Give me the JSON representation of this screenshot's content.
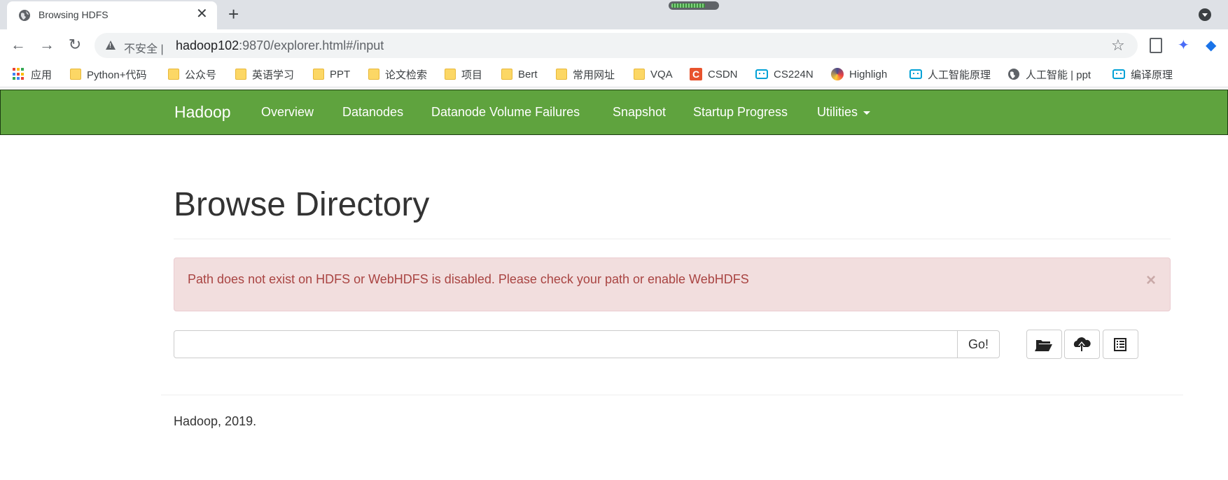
{
  "browser": {
    "tab_title": "Browsing HDFS",
    "tab_close": "✕",
    "new_tab": "+",
    "security_label": "不安全 |",
    "url_host": "hadoop102",
    "url_rest": ":9870/explorer.html#/input",
    "nav": {
      "back": "←",
      "forward": "→",
      "reload": "↻"
    },
    "star": "☆"
  },
  "bookmarks": [
    {
      "label": "应用",
      "icon": "apps-grid-icon"
    },
    {
      "label": "Python+代码",
      "icon": "folder-icon"
    },
    {
      "label": "公众号",
      "icon": "folder-icon"
    },
    {
      "label": "英语学习",
      "icon": "folder-icon"
    },
    {
      "label": "PPT",
      "icon": "folder-icon"
    },
    {
      "label": "论文检索",
      "icon": "folder-icon"
    },
    {
      "label": "项目",
      "icon": "folder-icon"
    },
    {
      "label": "Bert",
      "icon": "folder-icon"
    },
    {
      "label": "常用网址",
      "icon": "folder-icon"
    },
    {
      "label": "VQA",
      "icon": "folder-icon"
    },
    {
      "label": "CSDN",
      "icon": "csdn-icon"
    },
    {
      "label": "CS224N",
      "icon": "bilibili-icon"
    },
    {
      "label": "Highligh",
      "icon": "highlight-icon"
    },
    {
      "label": "人工智能原理",
      "icon": "bilibili-icon"
    },
    {
      "label": "人工智能 | ppt",
      "icon": "globe-icon"
    },
    {
      "label": "编译原理",
      "icon": "bilibili-icon"
    }
  ],
  "hadoop_nav": {
    "brand": "Hadoop",
    "links": [
      "Overview",
      "Datanodes",
      "Datanode Volume Failures",
      "Snapshot",
      "Startup Progress",
      "Utilities"
    ]
  },
  "main": {
    "title": "Browse Directory",
    "alert": "Path does not exist on HDFS or WebHDFS is disabled. Please check your path or enable WebHDFS",
    "alert_close": "×",
    "path_value": "",
    "go_label": "Go!",
    "tools": [
      "create-directory-icon",
      "upload-icon",
      "cut-paste-icon"
    ]
  },
  "footer": {
    "text": "Hadoop, 2019."
  },
  "colors": {
    "navbar": "#5fa33e",
    "alert_bg": "#f2dede",
    "alert_text": "#a94442",
    "folder": "#fcd765"
  }
}
